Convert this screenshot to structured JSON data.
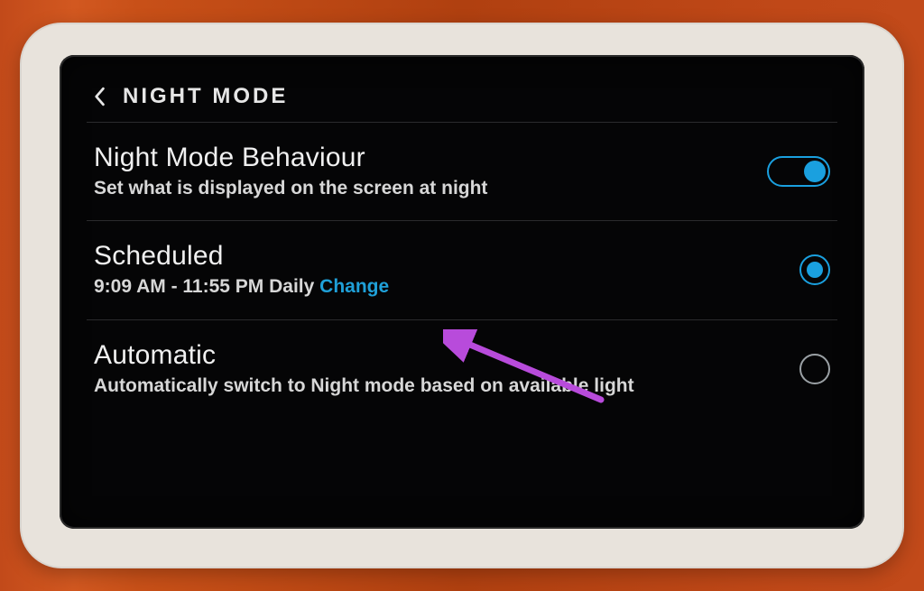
{
  "header": {
    "title": "NIGHT MODE"
  },
  "rows": {
    "behaviour": {
      "title": "Night Mode Behaviour",
      "subtitle": "Set what is displayed on the screen at night",
      "toggle_on": true
    },
    "scheduled": {
      "title": "Scheduled",
      "schedule_text": "9:09 AM - 11:55 PM Daily ",
      "change_label": "Change",
      "selected": true
    },
    "automatic": {
      "title": "Automatic",
      "subtitle": "Automatically switch to Night mode based on available light",
      "selected": false
    }
  },
  "colors": {
    "accent": "#1aa0df",
    "annotation": "#b84bdb"
  }
}
